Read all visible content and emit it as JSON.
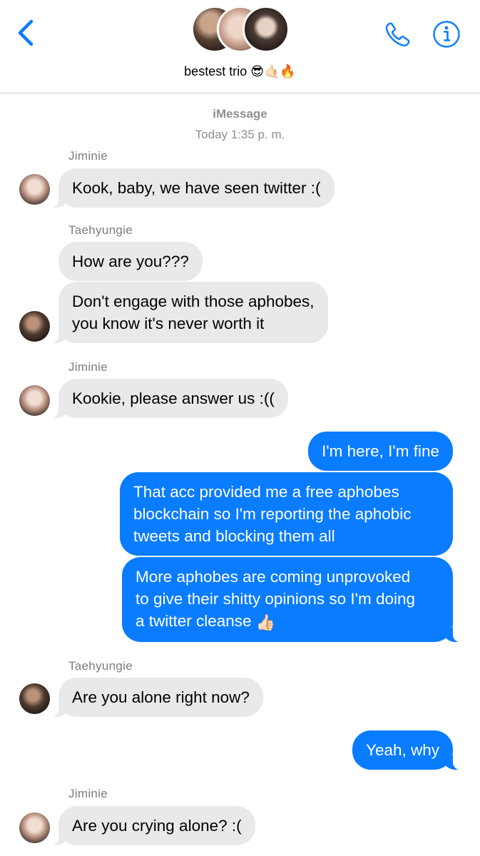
{
  "header": {
    "group_title": "bestest trio 😎🤙🏻🔥",
    "icons": [
      "chevron-left-icon",
      "phone-icon",
      "info-icon"
    ],
    "accent_color": "#0a7cff"
  },
  "thread": {
    "service": "iMessage",
    "timestamp": "Today 1:35 p. m."
  },
  "messages": [
    {
      "sender": "Jiminie",
      "text": "Kook, baby, we have seen twitter :("
    },
    {
      "sender": "Taehyungie",
      "text": "How are you???"
    },
    {
      "text_lines": [
        "Don't engage with those aphobes,",
        "you know it's never worth it"
      ]
    },
    {
      "sender": "Jiminie",
      "text": "Kookie, please answer us :(("
    },
    {
      "text": "I'm here, I'm fine"
    },
    {
      "text_lines": [
        "That acc provided me a free aphobes",
        "blockchain so I'm reporting the aphobic",
        "tweets and blocking them all"
      ]
    },
    {
      "text_lines": [
        "More aphobes are coming unprovoked",
        "to give their shitty opinions so I'm doing",
        "a twitter cleanse"
      ],
      "emoji": "👍🏻"
    },
    {
      "sender": "Taehyungie",
      "text": "Are you alone right now?"
    },
    {
      "text": "Yeah, why"
    },
    {
      "sender": "Jiminie",
      "text": "Are you crying alone? :("
    }
  ]
}
